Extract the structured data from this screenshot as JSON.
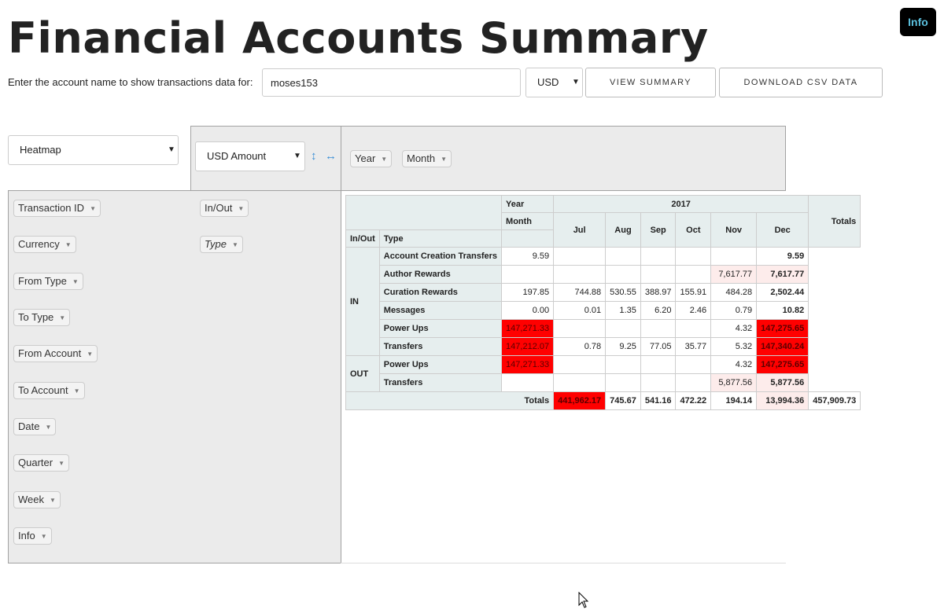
{
  "page": {
    "title": "Financial Accounts Summary",
    "info_button": "Info"
  },
  "controls": {
    "prompt": "Enter the account name to show transactions data for:",
    "account_value": "moses153",
    "currency": "USD",
    "view_button": "VIEW SUMMARY",
    "download_button": "DOWNLOAD CSV DATA"
  },
  "pivot": {
    "renderer": "Heatmap",
    "aggregator": "USD Amount",
    "col_attrs": [
      "Year",
      "Month"
    ],
    "row_attrs": [
      "In/Out",
      "Type"
    ],
    "unused_attrs": [
      "Transaction ID",
      "Currency",
      "From Type",
      "To Type",
      "From Account",
      "To Account",
      "Date",
      "Quarter",
      "Week",
      "Info"
    ]
  },
  "table": {
    "hdr_year": "Year",
    "hdr_month": "Month",
    "hdr_inout": "In/Out",
    "hdr_type": "Type",
    "year": "2017",
    "totals_label": "Totals",
    "months": [
      "Jul",
      "Aug",
      "Sep",
      "Oct",
      "Nov",
      "Dec"
    ],
    "groups": [
      {
        "label": "IN",
        "rows": [
          {
            "type": "Account Creation Transfers",
            "values": [
              "9.59",
              "",
              "",
              "",
              "",
              ""
            ],
            "total": "9.59"
          },
          {
            "type": "Author Rewards",
            "values": [
              "",
              "",
              "",
              "",
              "",
              "7,617.77"
            ],
            "total": "7,617.77"
          },
          {
            "type": "Curation Rewards",
            "values": [
              "197.85",
              "744.88",
              "530.55",
              "388.97",
              "155.91",
              "484.28"
            ],
            "total": "2,502.44"
          },
          {
            "type": "Messages",
            "values": [
              "0.00",
              "0.01",
              "1.35",
              "6.20",
              "2.46",
              "0.79"
            ],
            "total": "10.82"
          },
          {
            "type": "Power Ups",
            "values": [
              "147,271.33",
              "",
              "",
              "",
              "",
              "4.32"
            ],
            "total": "147,275.65"
          },
          {
            "type": "Transfers",
            "values": [
              "147,212.07",
              "0.78",
              "9.25",
              "77.05",
              "35.77",
              "5.32"
            ],
            "total": "147,340.24"
          }
        ]
      },
      {
        "label": "OUT",
        "rows": [
          {
            "type": "Power Ups",
            "values": [
              "147,271.33",
              "",
              "",
              "",
              "",
              "4.32"
            ],
            "total": "147,275.65"
          },
          {
            "type": "Transfers",
            "values": [
              "",
              "",
              "",
              "",
              "",
              "5,877.56"
            ],
            "total": "5,877.56"
          }
        ]
      }
    ],
    "col_totals": [
      "441,962.17",
      "745.67",
      "541.16",
      "472.22",
      "194.14",
      "13,994.36"
    ],
    "grand_total": "457,909.73"
  },
  "colors": {
    "heat_high": "#ff0000",
    "heat_low": "#fdeceb",
    "panel": "#ebebeb",
    "header_cell": "#e6eeee",
    "info_text": "#5bc0de"
  },
  "icons": [
    "vertical-arrows-icon",
    "horizontal-arrows-icon",
    "dropdown-caret-icon",
    "mouse-cursor-icon"
  ]
}
